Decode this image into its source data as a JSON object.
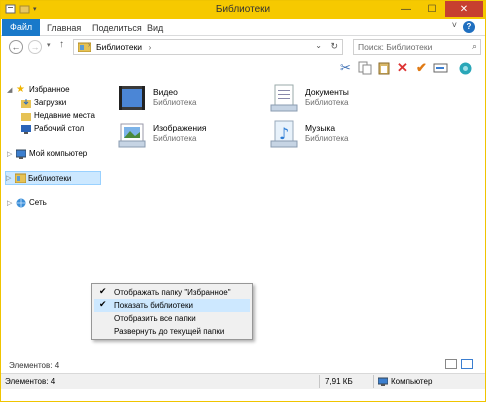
{
  "window": {
    "title": "Библиотеки",
    "controls": {
      "minimize": "—",
      "maximize": "☐",
      "close": "✕"
    }
  },
  "ribbon": {
    "tabs": [
      {
        "label": "Файл"
      },
      {
        "label": "Главная"
      },
      {
        "label": "Поделиться"
      },
      {
        "label": "Вид"
      }
    ],
    "help": "?"
  },
  "address": {
    "path": "Библиотеки",
    "search_placeholder": "Поиск: Библиотеки"
  },
  "nav_pane": {
    "favorites": "Избранное",
    "downloads": "Загрузки",
    "recent": "Недавние места",
    "desktop": "Рабочий стол",
    "computer": "Мой компьютер",
    "libraries": "Библиотеки",
    "network": "Сеть"
  },
  "libraries": [
    {
      "name": "Видео",
      "type": "Библиотека"
    },
    {
      "name": "Документы",
      "type": "Библиотека"
    },
    {
      "name": "Изображения",
      "type": "Библиотека"
    },
    {
      "name": "Музыка",
      "type": "Библиотека"
    }
  ],
  "context_menu": [
    {
      "label": "Отображать папку \"Избранное\"",
      "checked": true
    },
    {
      "label": "Показать библиотеки",
      "checked": true
    },
    {
      "label": "Отобразить все папки",
      "checked": false
    },
    {
      "label": "Развернуть до текущей папки",
      "checked": false
    }
  ],
  "status": {
    "items_count": "Элементов: 4",
    "bar_items": "Элементов: 4",
    "size": "7,91 КБ",
    "location": "Компьютер"
  },
  "colors": {
    "titlebar": "#f6c900",
    "file_tab": "#1979ca",
    "close": "#c7402f",
    "selection": "#cce8ff"
  }
}
